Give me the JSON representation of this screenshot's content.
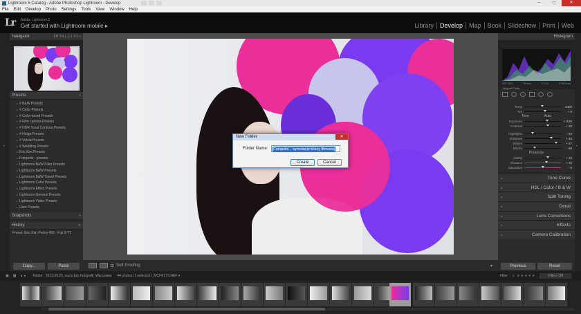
{
  "window": {
    "title": "Lightroom 5 Catalog - Adobe Photoshop Lightroom - Develop"
  },
  "menu": [
    "File",
    "Edit",
    "Develop",
    "Photo",
    "Settings",
    "Tools",
    "View",
    "Window",
    "Help"
  ],
  "identity": {
    "logo": "Lr",
    "app_name": "Adobe Lightroom 5",
    "tagline": "Get started with Lightroom mobile ▸"
  },
  "modules": [
    "Library",
    "Develop",
    "Map",
    "Book",
    "Slideshow",
    "Print",
    "Web"
  ],
  "active_module": "Develop",
  "navigator": {
    "title": "Navigator",
    "zoom_options": "FIT  FILL  1:1  3:1 ÷"
  },
  "presets": {
    "title": "Presets",
    "items": [
      "# B&W Presets",
      "# Color Presets",
      "# Color-toned Presets",
      "# Film camera Presets",
      "# HDR Tonal Contrast Presets",
      "# Holga Presets",
      "# Velvia Presets",
      "# Wedding Presets",
      "Eric Kim Presets",
      "Fotopolis - presets",
      "Lightroom B&W Filter Presets",
      "Lightroom B&W Presets",
      "Lightroom B&W Toned Presets",
      "Lightroom Color Presets",
      "Lightroom Effect Presets",
      "Lightroom General Presets",
      "Lightroom Video Presets",
      "User Presets"
    ]
  },
  "snapshots": {
    "title": "Snapshots"
  },
  "history": {
    "title": "History",
    "first_item": "Preset: Eric Kim Portra 400 - Fuji X-T1"
  },
  "left_buttons": {
    "copy": "Copy...",
    "paste": "Paste"
  },
  "dialog": {
    "title": "New Folder",
    "label": "Folder Name:",
    "value": "Fotopolis – symulacje kliszy filmowej",
    "create": "Create",
    "cancel": "Cancel"
  },
  "toolbar": {
    "soft_proofing": "Soft Proofing"
  },
  "histogram": {
    "title": "Histogram",
    "iso": "ISO 100",
    "focal": "70 mm",
    "aperture": "f / 2,8",
    "shutter": "1/160 sec",
    "original_photo": "Original Photo"
  },
  "basic": {
    "temp_label": "Temp",
    "temp_value": "4400",
    "tint_label": "Tint",
    "tint_value": "+ 9",
    "tone_label": "Tone",
    "auto_label": "Auto",
    "exposure_label": "Exposure",
    "exposure_value": "+ 0,90",
    "contrast_label": "Contrast",
    "contrast_value": "+ 20",
    "highlights_label": "Highlights",
    "highlights_value": "- 64",
    "shadows_label": "Shadows",
    "shadows_value": "+ 40",
    "whites_label": "Whites",
    "whites_value": "+ 67",
    "blacks_label": "Blacks",
    "blacks_value": "- 50",
    "presence_label": "Presence",
    "clarity_label": "Clarity",
    "clarity_value": "+ 20",
    "vibrance_label": "Vibrance",
    "vibrance_value": "+ 15",
    "saturation_label": "Saturation",
    "saturation_value": "- 5"
  },
  "right_sections": [
    "Tone Curve",
    "HSL / Color / B & W",
    "Split Toning",
    "Detail",
    "Lens Corrections",
    "Effects",
    "Camera Calibration"
  ],
  "right_buttons": {
    "previous": "Previous",
    "reset": "Reset"
  },
  "filmbar": {
    "source": "Folder : 2013.09.25_warsztaty fotografii_Warszawa",
    "count": "44 photos /1 selected /_MCH4173.NEF ▾",
    "filter_label": "Filter :",
    "filter_value": "Filters Off"
  },
  "colors": {
    "magenta": "#ea2f9a",
    "purple": "#7a3bf0",
    "lavender": "#b8b6e8",
    "selection": "#3470c8"
  }
}
